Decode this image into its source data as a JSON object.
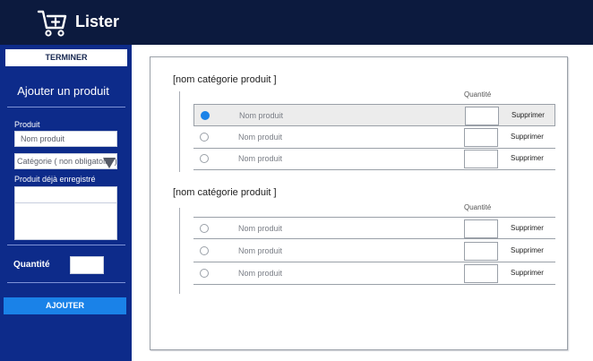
{
  "header": {
    "title": "Lister",
    "logo_icon": "shopping-cart-plus-icon"
  },
  "sidebar": {
    "finish_label": "TERMINER",
    "title": "Ajouter un produit",
    "product_label": "Produit",
    "product_placeholder": "Nom produit",
    "category_select": "Catégorie ( non obligatoire )",
    "existing_label": "Produit déjà enregistré",
    "quantity_label": "Quantité",
    "add_label": "AJOUTER"
  },
  "colors": {
    "header_bg": "#0c1a3e",
    "sidebar_bg": "#0d2b8a",
    "accent": "#1a82e8"
  },
  "categories": [
    {
      "name": "[nom catégorie produit ]",
      "quantity_header": "Quantité",
      "items": [
        {
          "name": "Nom produit",
          "delete_label": "Supprimer",
          "selected": true
        },
        {
          "name": "Nom produit",
          "delete_label": "Supprimer",
          "selected": false
        },
        {
          "name": "Nom produit",
          "delete_label": "Supprimer",
          "selected": false
        }
      ]
    },
    {
      "name": "[nom catégorie produit ]",
      "quantity_header": "Quantité",
      "items": [
        {
          "name": "Nom produit",
          "delete_label": "Supprimer",
          "selected": false
        },
        {
          "name": "Nom produit",
          "delete_label": "Supprimer",
          "selected": false
        },
        {
          "name": "Nom produit",
          "delete_label": "Supprimer",
          "selected": false
        }
      ]
    }
  ]
}
